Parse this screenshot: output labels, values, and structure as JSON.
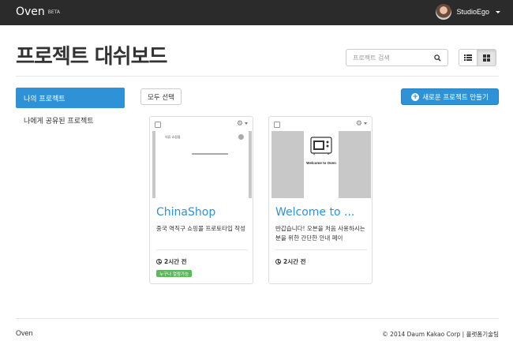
{
  "navbar": {
    "brand": "Oven",
    "beta": "BETA",
    "username": "StudioEgo"
  },
  "header": {
    "title": "프로젝트 대쉬보드",
    "search_placeholder": "프로젝트 검색",
    "view_modes": [
      "list",
      "grid"
    ],
    "active_view": "grid"
  },
  "sidebar": {
    "items": [
      {
        "label": "나의 프로젝트",
        "active": true
      },
      {
        "label": "나에게 공유된 프로젝트",
        "active": false
      }
    ]
  },
  "toolbar": {
    "select_all": "모두 선택",
    "new_project": "새로운 프로젝트 만들기"
  },
  "projects": [
    {
      "title": "ChinaShop",
      "description": "중국 역직구 쇼핑몰 프로토타입 작성",
      "time": "2시간 전",
      "badge": "누구나 열람가능",
      "thumb_logo": "의류 쇼핑몰"
    },
    {
      "title": "Welcome to ...",
      "description": "반갑습니다! 오븐을 처음 사용하시는 분을 위한 간단한 안내 페이",
      "time": "2시간 전",
      "thumb_text": "Welcome to Oven"
    }
  ],
  "footer": {
    "left": "Oven",
    "right": "© 2014 Daum Kakao Corp | 플랫폼기술팀"
  },
  "colors": {
    "navbar": "#2b2b2b",
    "accent": "#2f92d6",
    "badge": "#5cb85c"
  }
}
